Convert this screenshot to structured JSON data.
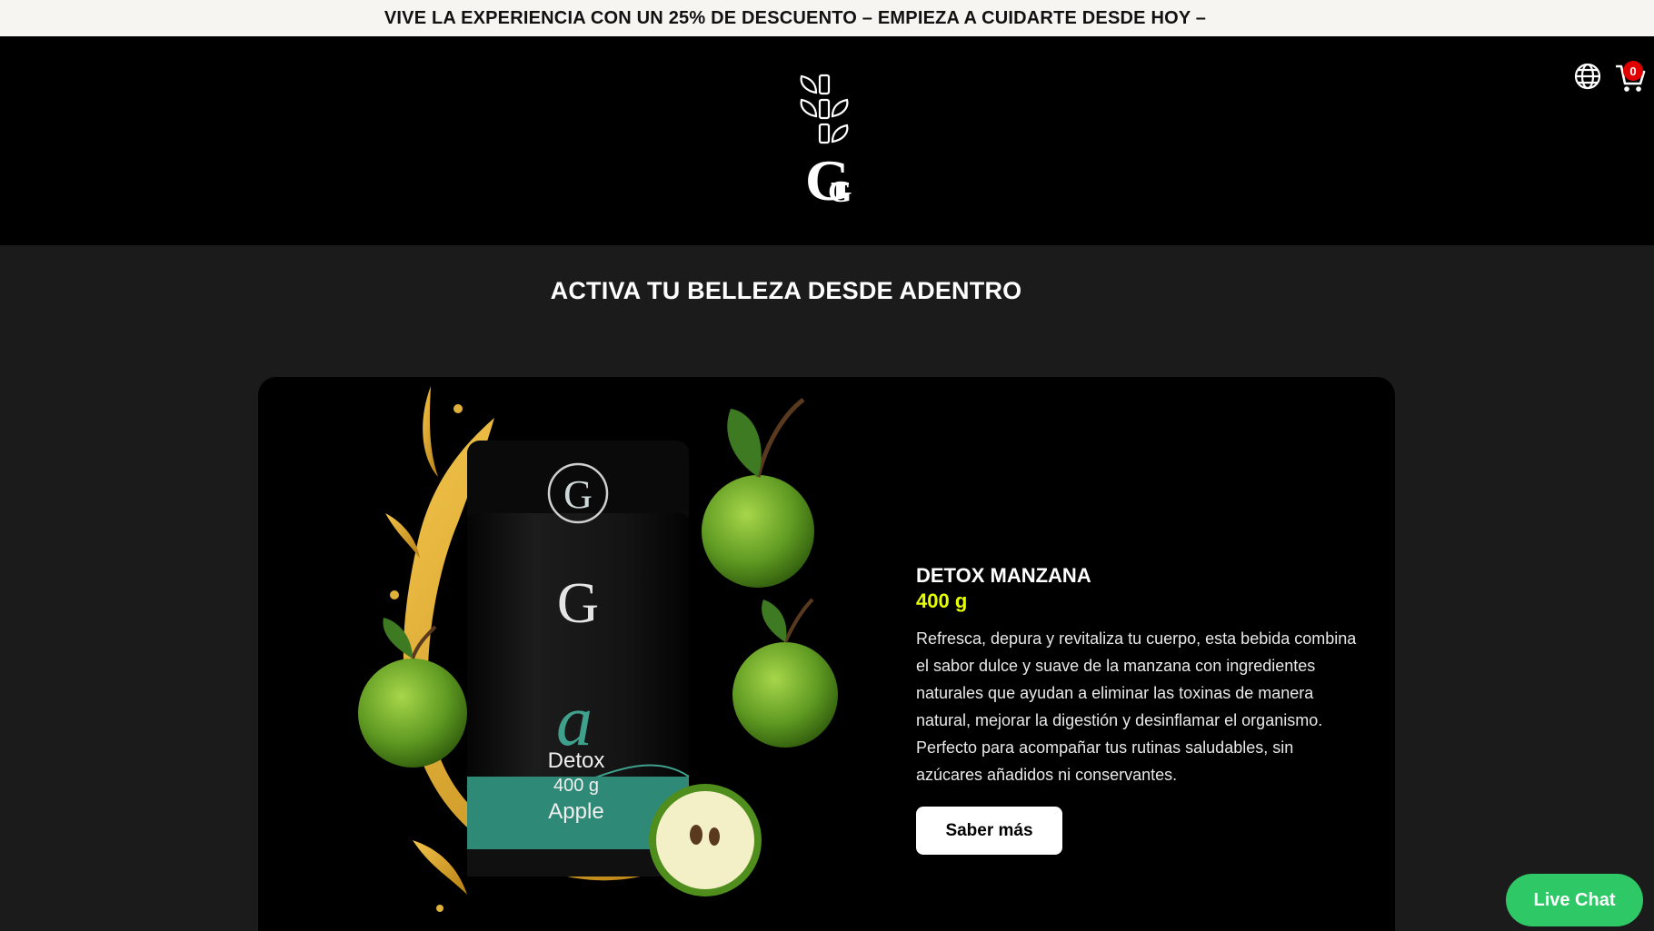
{
  "announcement": {
    "text": "VIVE LA EXPERIENCIA CON UN 25% DE DESCUENTO – EMPIEZA A CUIDARTE DESDE HOY –"
  },
  "header": {
    "logo_icon": "brand-logo",
    "globe_icon": "globe-icon",
    "cart_icon": "cart-icon",
    "cart_count": "0"
  },
  "section": {
    "title": "ACTIVA TU BELLEZA DESDE ADENTRO"
  },
  "product": {
    "name": "DETOX MANZANA",
    "size": "400 g",
    "description": "Refresca, depura y revitaliza tu cuerpo, esta bebida combina el sabor dulce y suave de la manzana con ingredientes naturales que ayudan a eliminar las toxinas de manera natural, mejorar la digestión y desinflamar el organismo. Perfecto para acompañar tus rutinas saludables, sin azúcares añadidos ni conservantes.",
    "button_label": "Saber más",
    "jar_label": {
      "brand": "G",
      "script": "a",
      "line1": "Detox",
      "line2": "400 g",
      "line3": "Apple"
    }
  },
  "chat": {
    "label": "Live Chat"
  },
  "colors": {
    "accent_yellow": "#e6ff00",
    "chat_green": "#2ec866",
    "badge_red": "#e10000"
  }
}
